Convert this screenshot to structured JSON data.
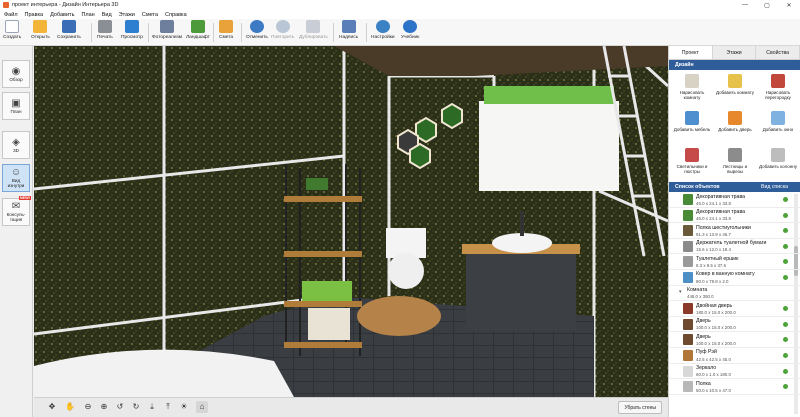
{
  "app": {
    "title": "проект интерьера - Дизайн Интерьера 3D"
  },
  "window_controls": [
    "—",
    "▢",
    "✕"
  ],
  "menu": [
    "Файл",
    "Правка",
    "Добавить",
    "План",
    "Вид",
    "Этажи",
    "Смета",
    "Справка"
  ],
  "toolbar": {
    "create": "Создать",
    "open": "Открыть",
    "save": "Сохранить",
    "print": "Печать",
    "preview": "Просмотр",
    "photorealism": "Фотореализм",
    "landscape": "Ландшафт",
    "estimate": "Смета",
    "undo": "Отменить",
    "redo": "Повторить",
    "duplicate": "Дублировать",
    "label": "Надпись",
    "settings": "Настройки",
    "tutorial": "Учебник"
  },
  "left_panel": {
    "overview": "Обзор",
    "plan": "План",
    "view3d": "3D",
    "interior_view": "Вид изнутри",
    "consult": "Консуль-тация",
    "new_badge": "NEW!"
  },
  "bottom_bar": {
    "remove_walls": "Убрать стены"
  },
  "right_panel": {
    "tabs": [
      "Проект",
      "Этажи",
      "Свойства"
    ],
    "design_title": "Дизайн",
    "design_buttons": [
      "Нарисовать комнату",
      "Добавить комнату",
      "Нарисовать перегородку",
      "Добавить мебель",
      "Добавить дверь",
      "Добавить окно",
      "Светильники и люстры",
      "Лестницы и вырезы",
      "Добавить колонну"
    ],
    "objects_title": "Список объектов",
    "objects_view": "Вид списка",
    "objects": [
      {
        "name": "Декоративная трава",
        "dims": "46.0 x 24.1 x 33.8",
        "group": false
      },
      {
        "name": "Декоративная трава",
        "dims": "46.0 x 24.1 x 33.8",
        "group": false
      },
      {
        "name": "Полка шестиугольники",
        "dims": "91.3 x 13.9 x 46.7",
        "group": false
      },
      {
        "name": "Держатель туалетной бумаги",
        "dims": "15.6 x 12.0 x 18.4",
        "group": false
      },
      {
        "name": "Туалетный ершик",
        "dims": "8.3 x 8.5 x 37.6",
        "group": false
      },
      {
        "name": "Ковер в ванную комнату",
        "dims": "80.0 x 79.8 x 2.0",
        "group": false
      },
      {
        "name": "Комната",
        "dims": "446.0 x 350.0",
        "group": true
      },
      {
        "name": "Двойная дверь",
        "dims": "180.0 x 15.0 x 200.0",
        "group": false
      },
      {
        "name": "Дверь",
        "dims": "100.0 x 15.0 x 200.0",
        "group": false
      },
      {
        "name": "Дверь",
        "dims": "100.0 x 15.0 x 200.0",
        "group": false
      },
      {
        "name": "Пуф Рэй",
        "dims": "42.5 x 42.5 x 45.0",
        "group": false
      },
      {
        "name": "Зеркало",
        "dims": "60.0 x 1.0 x 180.0",
        "group": false
      },
      {
        "name": "Полка",
        "dims": "50.0 x 10.5 x 47.0",
        "group": false
      }
    ]
  }
}
